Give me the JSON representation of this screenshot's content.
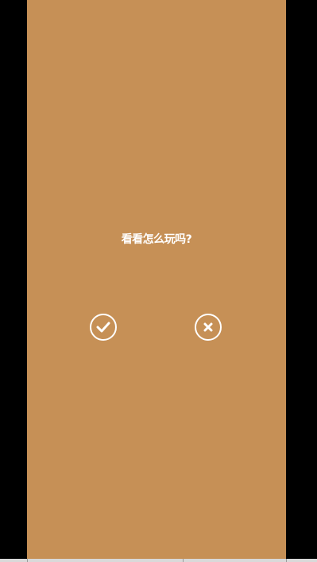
{
  "prompt": {
    "text": "看看怎么玩吗?"
  },
  "buttons": {
    "confirm": {
      "icon": "checkmark-icon"
    },
    "cancel": {
      "icon": "close-icon"
    }
  },
  "colors": {
    "background": "#c69056",
    "letterbox": "#000000",
    "foreground": "#ffffff"
  }
}
